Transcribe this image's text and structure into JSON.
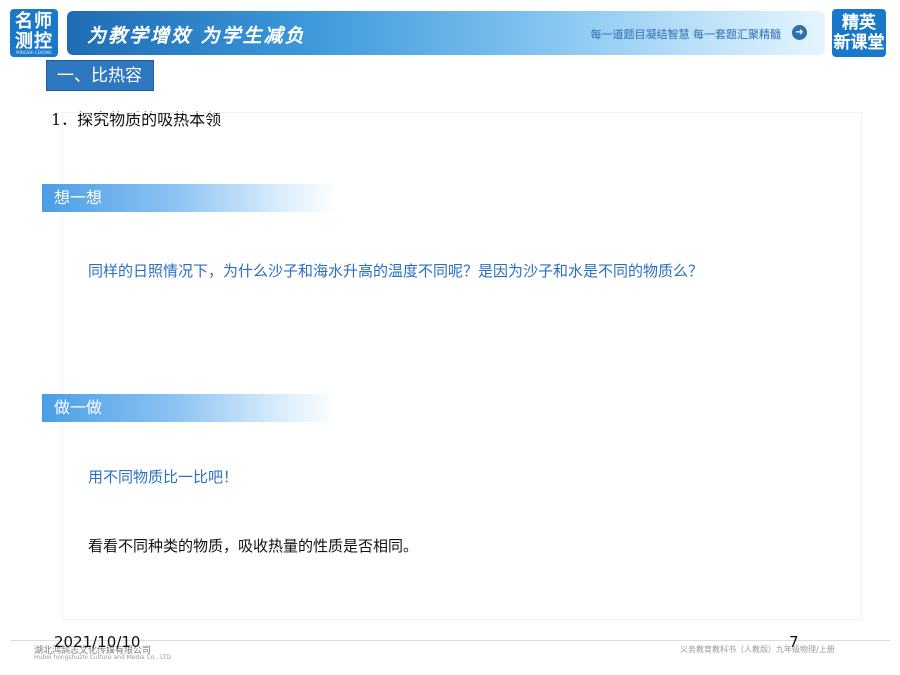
{
  "header": {
    "logo_left": {
      "line1": "名师",
      "line2": "测控",
      "sub": "MINGSHI CEKONG"
    },
    "slogan": "为教学增效 为学生减负",
    "tagline": "每一道题目凝结智慧 每一套题汇聚精髓",
    "arrow_icon": "arrow-right-icon",
    "logo_right": {
      "line1": "精英",
      "line2": "新课堂"
    },
    "colors": {
      "brand_blue": "#1a78c8",
      "banner_start": "#1f6cb3",
      "banner_end": "#e6f5ff"
    }
  },
  "section_title": "一、比热容",
  "subheading": "1．探究物质的吸热本领",
  "think": {
    "label": "想一想",
    "question": "同样的日照情况下，为什么沙子和海水升高的温度不同呢？是因为沙子和水是不同的物质么？"
  },
  "do": {
    "label": "做一做",
    "line1": "用不同物质比一比吧！",
    "line2": "看看不同种类的物质，吸收热量的性质是否相同。"
  },
  "footer": {
    "company": "湖北鸿鹄志文化传媒有限公司",
    "company_en": "Hubei hongshuzhi Culture and Media Co., LTD",
    "date": "2021/10/10",
    "page": "7",
    "series": "义务教育教科书（人教版）九年级物理/上册"
  }
}
